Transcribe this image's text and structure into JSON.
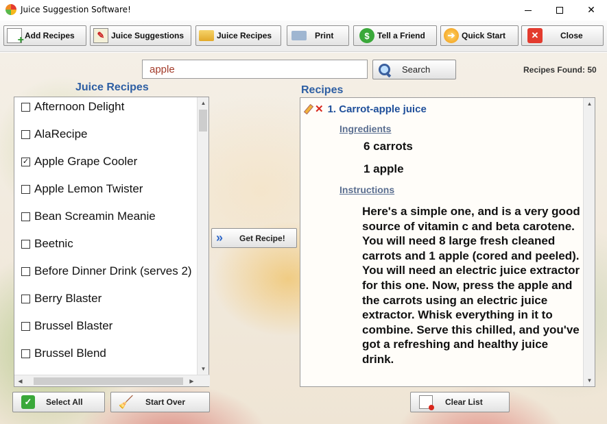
{
  "window": {
    "title": "Juice Suggestion Software!",
    "minimize_glyph": "",
    "maximize_glyph": "",
    "close_glyph": "✕"
  },
  "toolbar": {
    "buttons": [
      {
        "label": "Add Recipes",
        "icon": "add-recipe-icon"
      },
      {
        "label": "Juice Suggestions",
        "icon": "suggestion-notepad-icon"
      },
      {
        "label": "Juice Recipes",
        "icon": "folder-icon"
      },
      {
        "label": "Print",
        "icon": "printer-icon"
      },
      {
        "label": "Tell a Friend",
        "icon": "dollar-icon"
      },
      {
        "label": "Quick Start",
        "icon": "quick-start-icon"
      },
      {
        "label": "Close",
        "icon": "close-icon"
      }
    ]
  },
  "search": {
    "value": "apple",
    "button_label": "Search",
    "results_found": "Recipes Found: 50"
  },
  "juice_recipes": {
    "title": "Juice Recipes",
    "items": [
      {
        "label": "Afternoon Delight",
        "checked": false
      },
      {
        "label": "AlaRecipe",
        "checked": false
      },
      {
        "label": "Apple Grape Cooler",
        "checked": true
      },
      {
        "label": "Apple Lemon Twister",
        "checked": false
      },
      {
        "label": "Bean Screamin Meanie",
        "checked": false
      },
      {
        "label": "Beetnic",
        "checked": false
      },
      {
        "label": "Before Dinner Drink (serves 2)",
        "checked": false
      },
      {
        "label": "Berry Blaster",
        "checked": false
      },
      {
        "label": "Brussel Blaster",
        "checked": false
      },
      {
        "label": "Brussel Blend",
        "checked": false
      }
    ]
  },
  "get_recipe_label": "Get Recipe!",
  "recipes": {
    "title": "Recipes",
    "entry": {
      "heading": "1. Carrot-apple juice",
      "ingredients_label": "Ingredients",
      "ingredients": [
        "6 carrots",
        "1 apple"
      ],
      "instructions_label": "Instructions",
      "instructions": "Here's a simple one, and is a very good source of vitamin c and beta carotene. You will need 8 large fresh cleaned carrots and 1 apple (cored and peeled). You will need an electric juice extractor for this one. Now, press the apple and the carrots using an electric juice extractor. Whisk everything in it to combine. Serve this chilled, and you've got a refreshing and healthy juice drink."
    }
  },
  "bottom": {
    "select_all": "Select All",
    "start_over": "Start Over",
    "clear_list": "Clear List"
  },
  "colors": {
    "accent": "#2d5ea3",
    "recipe_heading": "#1f4f9a",
    "search_text": "#a33b2a"
  }
}
